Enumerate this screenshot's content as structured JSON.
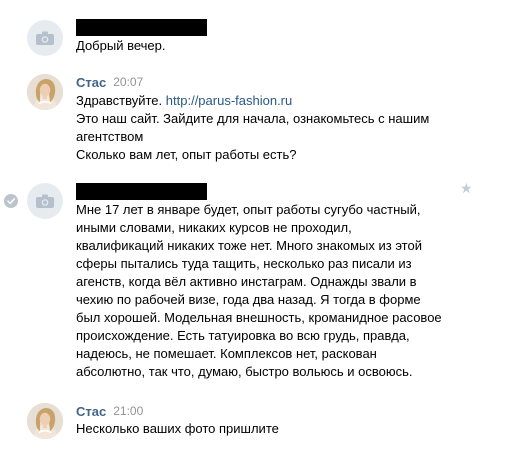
{
  "messages": [
    {
      "author_redacted": true,
      "lines": [
        "Добрый вечер."
      ]
    },
    {
      "author": "Стас",
      "time": "20:07",
      "greeting": "Здравствуйте.",
      "link": "http://parus-fashion.ru",
      "lines": [
        "Это наш сайт. Зайдите для начала, ознакомьтесь с нашим",
        "агентством",
        "Сколько вам лет, опыт работы есть?"
      ]
    },
    {
      "author_redacted": true,
      "lines": [
        "Мне 17 лет в январе будет, опыт работы сугубо частный,",
        "иными словами, никаких курсов не проходил,",
        "квалификаций никаких тоже нет. Много знакомых из этой",
        "сферы пытались туда тащить, несколько раз писали из",
        "агенств, когда вёл активно инстаграм. Однажды звали в",
        "чехию по рабочей визе, года два назад. Я тогда в форме",
        "был хорошей. Модельная внешность, кроманидное расовое",
        "происхождение. Есть татуировка во всю грудь, правда,",
        "надеюсь, не помешает. Комплексов нет, раскован",
        "абсолютно, так что, думаю, быстро вольюсь и освоюсь."
      ]
    },
    {
      "author": "Стас",
      "time": "21:00",
      "lines": [
        "Несколько ваших фото пришлите"
      ]
    }
  ],
  "icons": {
    "placeholder_avatar": "camera-icon",
    "read_mark": "check-icon",
    "favorite": "star-icon"
  },
  "colors": {
    "author_name": "#42648b",
    "link": "#2a5885",
    "timestamp": "#939393",
    "placeholder_avatar_bg": "#e6ebf0"
  }
}
